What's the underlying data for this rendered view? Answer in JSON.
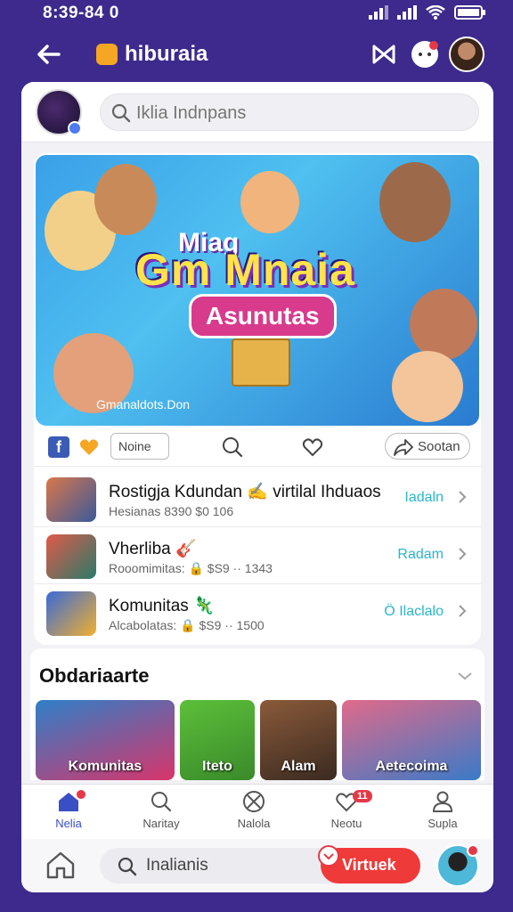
{
  "status_bar": {
    "time": "8:39-84 0"
  },
  "app_bar": {
    "title": "hiburaia"
  },
  "search": {
    "placeholder": "Iklia Indnpans"
  },
  "banner": {
    "line1": "Miag",
    "line2": "Gm Mnaia",
    "line3": "Asunutas",
    "caption": "Gmanaldots.Don"
  },
  "actions": {
    "tag_label": "Noine",
    "share_label": "Sootan"
  },
  "list": [
    {
      "title": "Rostigja Kdundan ✍ virtilal Ihduaos",
      "subtitle": "Hesianas 8390 $0   106",
      "action": "Iadaln"
    },
    {
      "title": "Vherliba 🎸",
      "subtitle": "Rooomimitas: 🔒 $S9 ·· 1343",
      "action": "Radam"
    },
    {
      "title": "Komunitas 🦎",
      "subtitle": "Alcabolatas: 🔒 $S9 ·· 1500",
      "action": "Ö Ilaclalo"
    }
  ],
  "section": {
    "title": "Obdariaarte",
    "tiles": [
      {
        "label": "Komunitas",
        "color_a": "#2e7fc8",
        "color_b": "#d8356a"
      },
      {
        "label": "Iteto",
        "color_a": "#5cbf3a",
        "color_b": "#3a8a2a"
      },
      {
        "label": "Alam",
        "color_a": "#8a5a3a",
        "color_b": "#3a2a20"
      },
      {
        "label": "Aetecoima",
        "color_a": "#e06a8a",
        "color_b": "#3a7ac8"
      }
    ]
  },
  "nav": [
    {
      "label": "Nelia",
      "icon": "home-icon",
      "badge": ""
    },
    {
      "label": "Naritay",
      "icon": "search-icon",
      "badge": ""
    },
    {
      "label": "Nalola",
      "icon": "compass-icon",
      "badge": ""
    },
    {
      "label": "Neotu",
      "icon": "heart-icon",
      "badge": "11"
    },
    {
      "label": "Supla",
      "icon": "person-icon",
      "badge": ""
    }
  ],
  "footer": {
    "search_label": "Inalianis",
    "button_label": "Virtuek"
  },
  "colors": {
    "background": "#3d2a8c",
    "accent": "#3b4fc4",
    "action": "#2ab5c8",
    "red": "#ef3a3a"
  }
}
